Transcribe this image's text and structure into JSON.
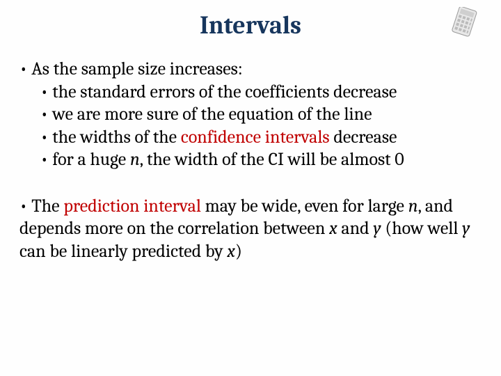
{
  "title": "Intervals",
  "p1": {
    "lead": "• As the sample size increases:",
    "b1": "• the standard errors of the coefficients decrease",
    "b2": "• we are more sure of the equation of the line",
    "b3_pre": "• the widths of the ",
    "b3_hl": "confidence intervals",
    "b3_post": " decrease",
    "b4_pre": "• for a huge ",
    "b4_n": "n",
    "b4_post": ", the width of the CI will be almost 0"
  },
  "p2": {
    "a": "• The ",
    "hl": "prediction interval",
    "b": " may be wide, even for large ",
    "n1": "n",
    "c": ", and depends more on the correlation between ",
    "x1": "x",
    "d": " and ",
    "y1": "y",
    "e": " (how well ",
    "y2": "y",
    "f": " can be linearly predicted by ",
    "x2": "x",
    "g": ")"
  }
}
